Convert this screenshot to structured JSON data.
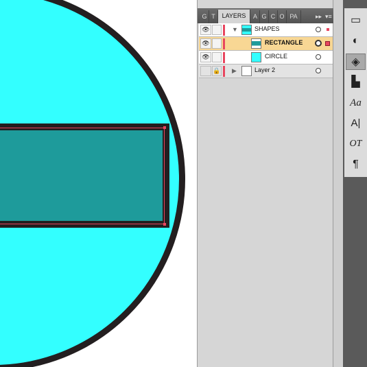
{
  "tabs": [
    {
      "label": "G",
      "active": false
    },
    {
      "label": "T",
      "active": false
    },
    {
      "label": "LAYERS",
      "active": true
    },
    {
      "label": "A",
      "active": false
    },
    {
      "label": "G",
      "active": false
    },
    {
      "label": "C",
      "active": false
    },
    {
      "label": "O",
      "active": false
    },
    {
      "label": "PA",
      "active": false
    }
  ],
  "tab_controls": {
    "expand": "▸▸",
    "menu": "▾≡"
  },
  "layers": [
    {
      "name": "SHAPES",
      "type": "layer",
      "visible": true,
      "expanded": true,
      "selected": false
    },
    {
      "name": "RECTANGLE",
      "type": "sublayer",
      "visible": true,
      "selected": true
    },
    {
      "name": "CIRCLE",
      "type": "sublayer",
      "visible": true,
      "selected": false
    },
    {
      "name": "Layer 2",
      "type": "layer",
      "visible": false,
      "locked": true,
      "expanded": false,
      "selected": false
    }
  ],
  "tools": [
    {
      "icon": "gradient-icon",
      "glyph": "▭"
    },
    {
      "icon": "transparency-icon",
      "glyph": "◐"
    },
    {
      "icon": "layers-icon",
      "glyph": "◈",
      "active": true
    },
    {
      "icon": "align-icon",
      "glyph": "▙"
    },
    {
      "icon": "character-style-icon",
      "glyph": "Aa"
    },
    {
      "icon": "character-icon",
      "glyph": "A|"
    },
    {
      "icon": "opentype-icon",
      "glyph": "OT"
    },
    {
      "icon": "paragraph-icon",
      "glyph": "¶"
    }
  ],
  "colors": {
    "circle_fill": "#33ffff",
    "rect_fill": "#1e9b9b",
    "stroke": "#231f20",
    "selection": "#e8465f",
    "selected_row": "#f8d794"
  }
}
